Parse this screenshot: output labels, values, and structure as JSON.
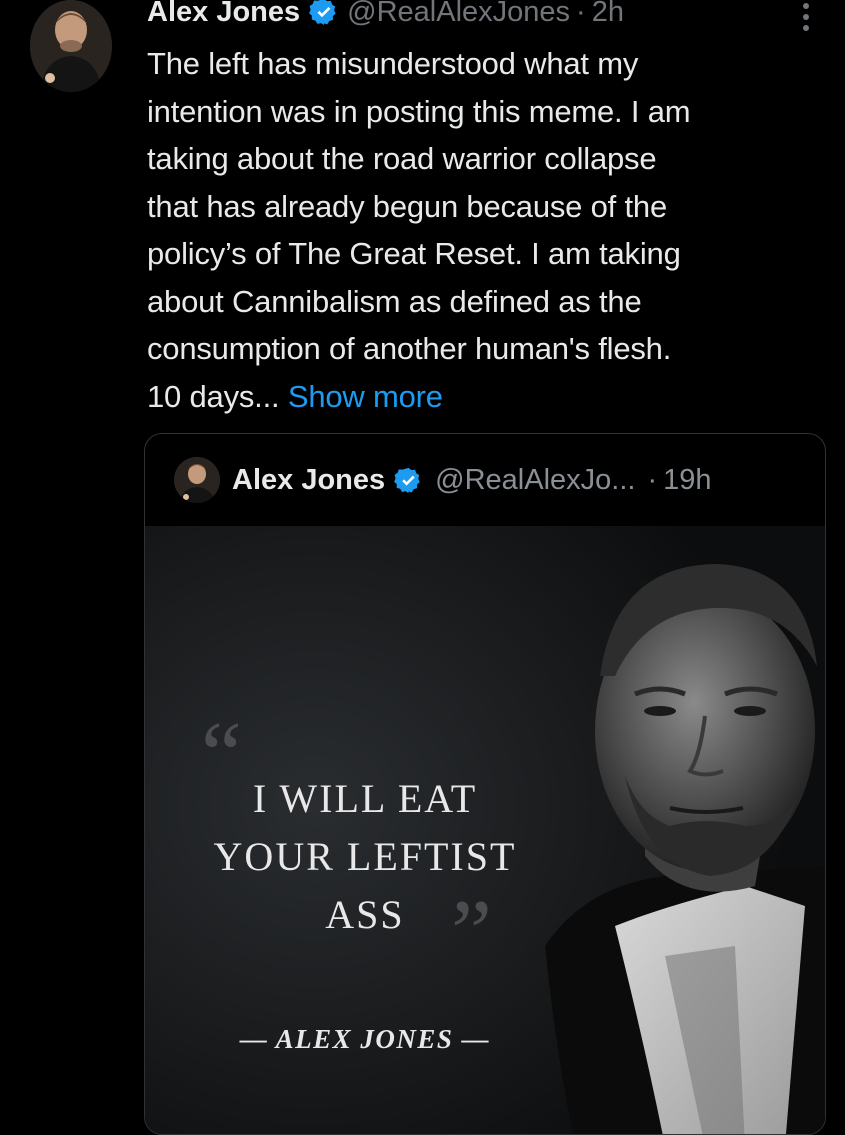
{
  "post": {
    "author_name": "Alex Jones",
    "handle": "@RealAlexJones",
    "separator": "·",
    "time": "2h",
    "body_lines": [
      "The left has misunderstood what my",
      "intention was in posting this meme. I am",
      "taking about the road warrior collapse",
      "that has already begun because of the",
      "policy’s of The Great Reset. I am taking",
      "about Cannibalism as defined as the",
      "consumption of another human's flesh.",
      "10 days..."
    ],
    "show_more": "Show more"
  },
  "quoted_post": {
    "author_name": "Alex Jones",
    "handle": "@RealAlexJo...",
    "separator": "·",
    "time": "19h",
    "image": {
      "open_quote": "“",
      "quote_lines": [
        "I WILL EAT",
        "YOUR LEFTIST",
        "ASS"
      ],
      "close_quote": "”",
      "attribution": "— ALEX JONES —"
    }
  },
  "icons": {
    "verified": "verified-badge-icon",
    "more": "more-options-icon"
  },
  "colors": {
    "background": "#000000",
    "text_primary": "#e7e9ea",
    "text_secondary": "#71767b",
    "link": "#1d9bf0",
    "verified": "#1d9bf0",
    "border": "#2f3336"
  }
}
